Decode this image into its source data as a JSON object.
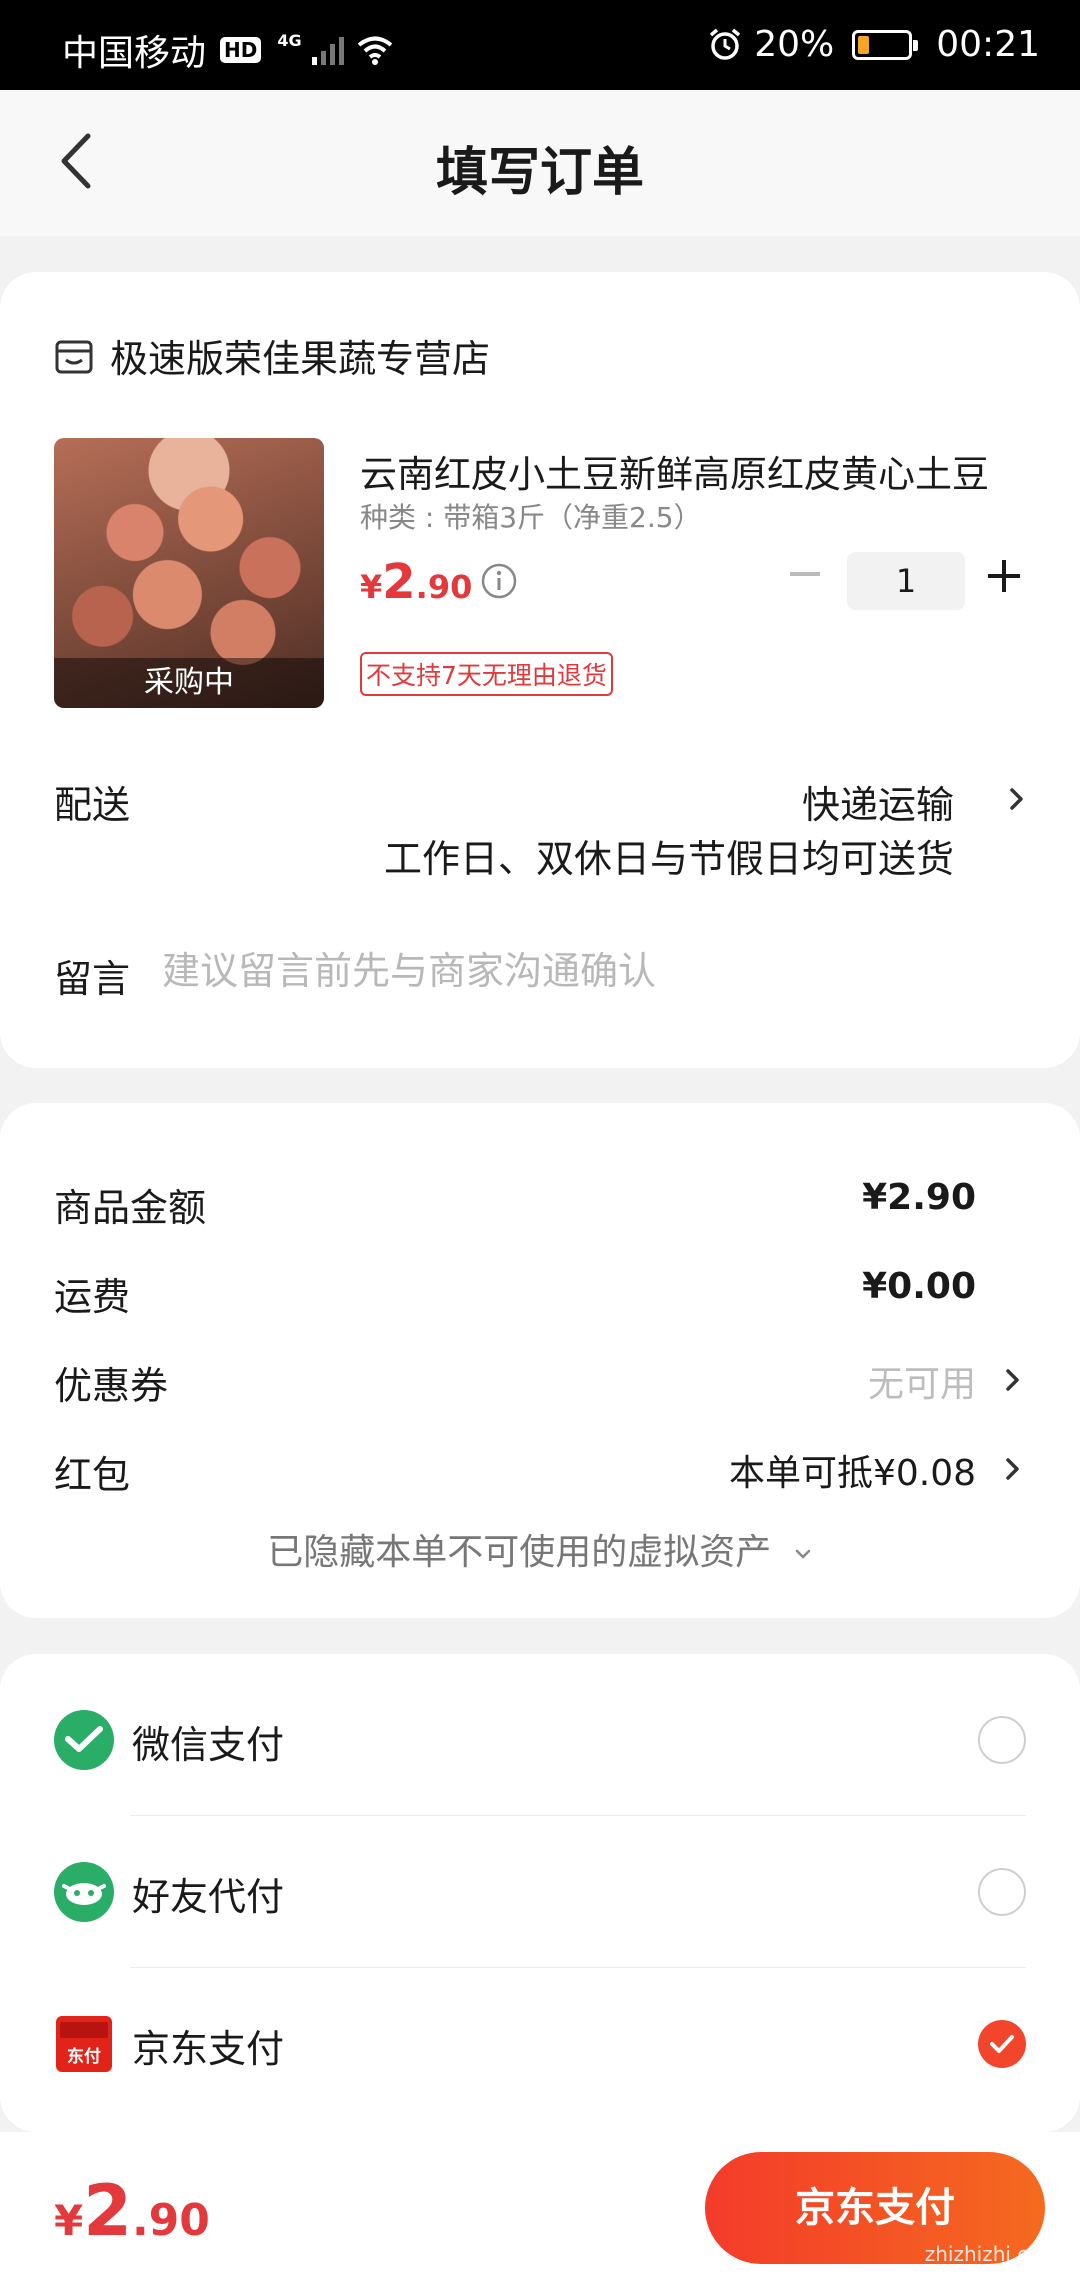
{
  "status": {
    "carrier": "中国移动",
    "hd": "HD",
    "network": "4G",
    "battery": "20%",
    "time": "00:21",
    "battery_color": "#f5a623"
  },
  "nav": {
    "title": "填写订单",
    "back_icon": "chevron-left-icon"
  },
  "shop": {
    "icon": "store-icon",
    "name": "极速版荣佳果蔬专营店"
  },
  "product": {
    "title": "云南红皮小土豆新鲜高原红皮黄心土豆",
    "spec": "种类 : 带箱3斤（净重2.5）",
    "price_symbol": "¥",
    "price_int": "2",
    "price_dec": ".90",
    "image_label": "采购中",
    "quantity": "1",
    "return_policy": "不支持7天无理由退货"
  },
  "delivery": {
    "label": "配送",
    "method": "快递运输",
    "note": "工作日、双休日与节假日均可送货"
  },
  "message": {
    "label": "留言",
    "placeholder": "建议留言前先与商家沟通确认"
  },
  "summary": {
    "items": [
      {
        "label": "商品金额",
        "value": "¥2.90"
      },
      {
        "label": "运费",
        "value": "¥0.00"
      },
      {
        "label": "优惠券",
        "value": "无可用"
      },
      {
        "label": "红包",
        "value": "本单可抵¥0.08"
      }
    ],
    "hidden_assets": "已隐藏本单不可使用的虚拟资产"
  },
  "payment": {
    "methods": [
      {
        "label": "微信支付",
        "icon": "wechat-pay-icon",
        "selected": false
      },
      {
        "label": "好友代付",
        "icon": "friend-pay-icon",
        "selected": false
      },
      {
        "label": "京东支付",
        "icon": "jd-pay-icon",
        "selected": true
      }
    ],
    "jd_icon_text": "东付"
  },
  "bottom": {
    "total_symbol": "¥",
    "total_int": "2",
    "total_dec": ".90",
    "pay_button": "京东支付",
    "watermark": "zhizhizhi.com"
  },
  "colors": {
    "accent_red": "#e4393c",
    "wechat_green": "#2aae67",
    "pay_gradient_start": "#f43b2a",
    "pay_gradient_end": "#f56a1f"
  }
}
